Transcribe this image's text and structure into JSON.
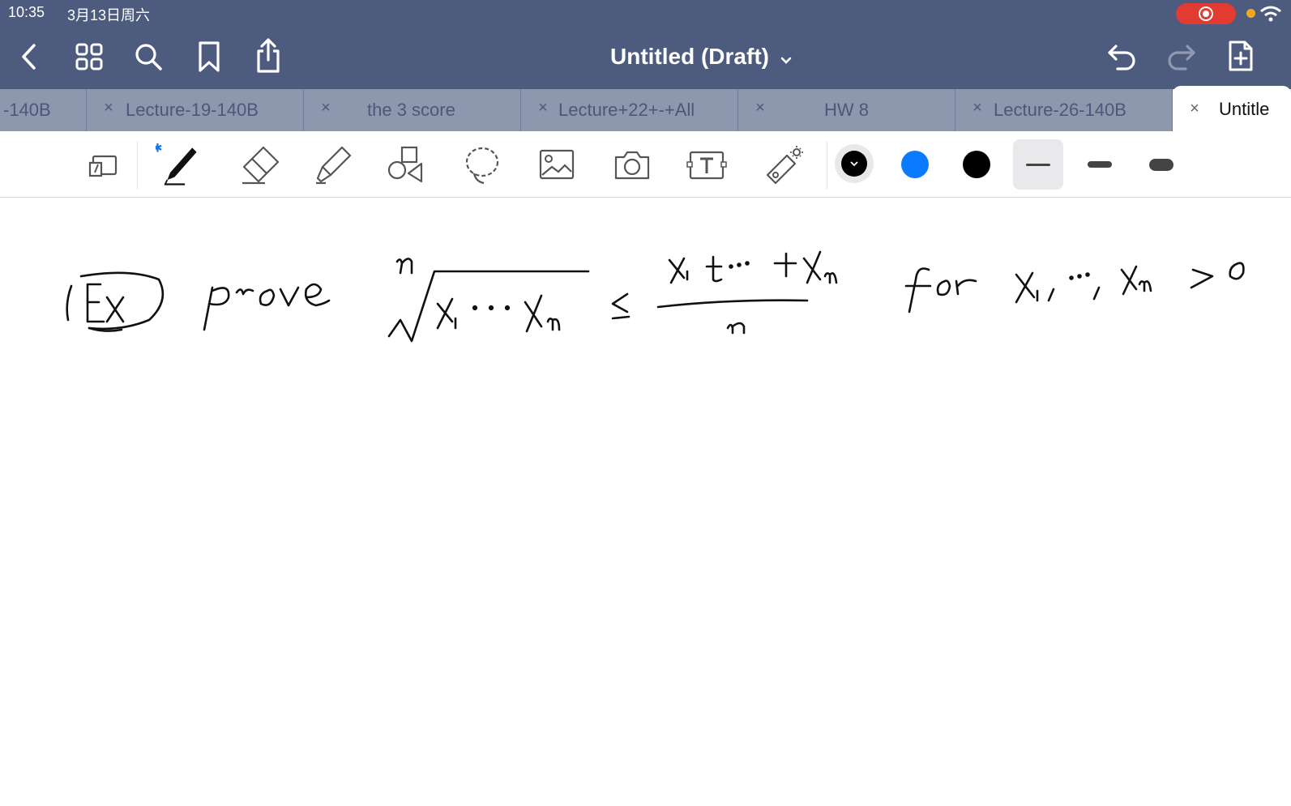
{
  "status": {
    "time": "10:35",
    "date": "3月13日周六",
    "recording": true
  },
  "nav": {
    "back_icon": "chevron-left-icon",
    "grid_icon": "grid-icon",
    "search_icon": "search-icon",
    "bookmark_icon": "bookmark-icon",
    "share_icon": "share-icon",
    "undo_icon": "undo-icon",
    "redo_icon": "redo-icon",
    "add_page_icon": "add-page-icon"
  },
  "title": "Untitled (Draft)",
  "tabs": [
    {
      "label": "-140B"
    },
    {
      "label": "Lecture-19-140B"
    },
    {
      "label": "the 3 score"
    },
    {
      "label": "Lecture+22+-+All"
    },
    {
      "label": "HW 8"
    },
    {
      "label": "Lecture-26-140B"
    },
    {
      "label": "Untitle"
    }
  ],
  "tools": [
    {
      "name": "read-only-toggle",
      "icon": "read-only-icon"
    },
    {
      "name": "pen",
      "icon": "pen-icon",
      "bluetooth": true
    },
    {
      "name": "eraser",
      "icon": "eraser-icon"
    },
    {
      "name": "highlighter",
      "icon": "highlighter-icon"
    },
    {
      "name": "shapes",
      "icon": "shapes-icon"
    },
    {
      "name": "lasso",
      "icon": "lasso-icon"
    },
    {
      "name": "image",
      "icon": "image-icon"
    },
    {
      "name": "camera",
      "icon": "camera-icon"
    },
    {
      "name": "text",
      "icon": "text-box-icon"
    },
    {
      "name": "laser-pointer",
      "icon": "laser-pointer-icon"
    }
  ],
  "colors": {
    "accent": "#4c5b7e",
    "pen_active": "#000000",
    "swatches": [
      "#0a7aff",
      "#000000"
    ]
  },
  "stroke_widths": [
    "thin",
    "medium",
    "thick"
  ],
  "selected_stroke_width": "thin",
  "handwriting": "(Ex) prove ⁿ√(x₁···xₙ) ≤ (x₁+···+xₙ)/n for x₁,···,xₙ > 0"
}
